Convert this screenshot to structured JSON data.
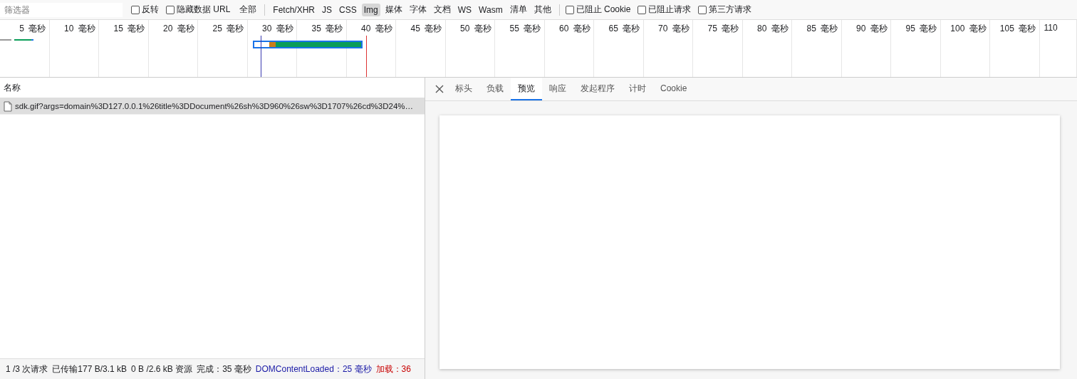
{
  "filter_bar": {
    "search": {
      "placeholder": "筛选器"
    },
    "options": [
      {
        "label": "反转",
        "checked": false
      },
      {
        "label": "隐藏数据 URL",
        "checked": false
      }
    ],
    "types": [
      {
        "label": "全部",
        "selected": false
      },
      {
        "label": "Fetch/XHR",
        "selected": false
      },
      {
        "label": "JS",
        "selected": false
      },
      {
        "label": "CSS",
        "selected": false
      },
      {
        "label": "Img",
        "selected": true
      },
      {
        "label": "媒体",
        "selected": false
      },
      {
        "label": "字体",
        "selected": false
      },
      {
        "label": "文档",
        "selected": false
      },
      {
        "label": "WS",
        "selected": false
      },
      {
        "label": "Wasm",
        "selected": false
      },
      {
        "label": "清单",
        "selected": false
      },
      {
        "label": "其他",
        "selected": false
      }
    ],
    "blocking": [
      {
        "label": "已阻止 Cookie",
        "checked": false
      },
      {
        "label": "已阻止请求",
        "checked": false
      },
      {
        "label": "第三方请求",
        "checked": false
      }
    ]
  },
  "timeline": {
    "ticks": [
      {
        "value": "5",
        "unit": "毫秒"
      },
      {
        "value": "10",
        "unit": "毫秒"
      },
      {
        "value": "15",
        "unit": "毫秒"
      },
      {
        "value": "20",
        "unit": "毫秒"
      },
      {
        "value": "25",
        "unit": "毫秒"
      },
      {
        "value": "30",
        "unit": "毫秒"
      },
      {
        "value": "35",
        "unit": "毫秒"
      },
      {
        "value": "40",
        "unit": "毫秒"
      },
      {
        "value": "45",
        "unit": "毫秒"
      },
      {
        "value": "50",
        "unit": "毫秒"
      },
      {
        "value": "55",
        "unit": "毫秒"
      },
      {
        "value": "60",
        "unit": "毫秒"
      },
      {
        "value": "65",
        "unit": "毫秒"
      },
      {
        "value": "70",
        "unit": "毫秒"
      },
      {
        "value": "75",
        "unit": "毫秒"
      },
      {
        "value": "80",
        "unit": "毫秒"
      },
      {
        "value": "85",
        "unit": "毫秒"
      },
      {
        "value": "90",
        "unit": "毫秒"
      },
      {
        "value": "95",
        "unit": "毫秒"
      },
      {
        "value": "100",
        "unit": "毫秒"
      },
      {
        "value": "105",
        "unit": "毫秒"
      },
      {
        "value": "110"
      }
    ]
  },
  "requests": {
    "column": "名称",
    "rows": [
      {
        "name": "sdk.gif?args=domain%3D127.0.0.1%26title%3DDocument%26sh%3D960%26sw%3D1707%26cd%3D24%…",
        "selected": true
      }
    ]
  },
  "detail": {
    "tabs": [
      {
        "label": "标头",
        "selected": false
      },
      {
        "label": "负载",
        "selected": false
      },
      {
        "label": "预览",
        "selected": true
      },
      {
        "label": "响应",
        "selected": false
      },
      {
        "label": "发起程序",
        "selected": false
      },
      {
        "label": "计时",
        "selected": false
      },
      {
        "label": "Cookie",
        "selected": false
      }
    ]
  },
  "status_bar": [
    {
      "text": "1 /3 次请求",
      "kind": "plain"
    },
    {
      "text": "已传输177 B/3.1 kB",
      "kind": "plain"
    },
    {
      "text": "0 B /2.6 kB 资源",
      "kind": "plain"
    },
    {
      "text": "完成：35 毫秒",
      "kind": "plain"
    },
    {
      "text": "DOMContentLoaded：25 毫秒",
      "kind": "dom"
    },
    {
      "text": "加载：36",
      "kind": "load"
    }
  ]
}
